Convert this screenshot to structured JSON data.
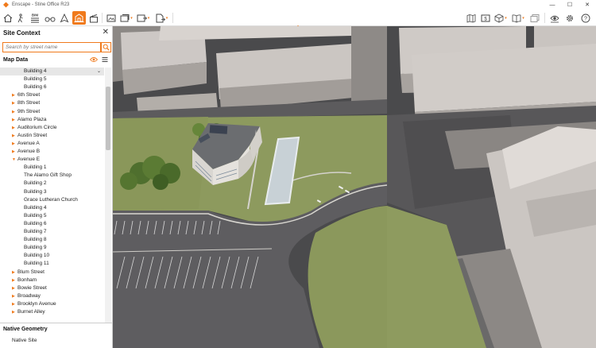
{
  "window": {
    "title": "Enscape - Stine Office R23",
    "controls": {
      "minimize": "—",
      "maximize": "☐",
      "close": "✕"
    }
  },
  "toolbar": {
    "bim_label": "BIM",
    "left_icons": [
      "home-icon",
      "walk-icon",
      "bim-info-icon",
      "binoculars-icon",
      "compass-icon",
      "site-context-icon",
      "clapperboard-icon"
    ],
    "middle_icons": [
      "screenshot-icon",
      "batch-render-icon",
      "export-image-icon",
      "export-web-icon"
    ],
    "right_icons": [
      "map-icon",
      "dollar-icon",
      "cube-icon",
      "book-icon",
      "material-icon",
      "visibility-icon",
      "settings-icon",
      "help-icon"
    ],
    "active_tool": "site-context-icon",
    "accent_color": "#f07a1c"
  },
  "panel": {
    "title": "Site Context",
    "search_placeholder": "Search by street name",
    "map_data_label": "Map Data",
    "tree": [
      {
        "label": "Building 4",
        "level": 1,
        "selected": true
      },
      {
        "label": "Building 5",
        "level": 1
      },
      {
        "label": "Building 6",
        "level": 1
      },
      {
        "label": "6th Street",
        "level": 0,
        "expanded": false
      },
      {
        "label": "8th Street",
        "level": 0,
        "expanded": false
      },
      {
        "label": "9th Street",
        "level": 0,
        "expanded": false
      },
      {
        "label": "Alamo Plaza",
        "level": 0,
        "expanded": false
      },
      {
        "label": "Auditorium Circle",
        "level": 0,
        "expanded": false
      },
      {
        "label": "Austin Street",
        "level": 0,
        "expanded": false
      },
      {
        "label": "Avenue A",
        "level": 0,
        "expanded": false
      },
      {
        "label": "Avenue B",
        "level": 0,
        "expanded": false
      },
      {
        "label": "Avenue E",
        "level": 0,
        "expanded": true
      },
      {
        "label": "Building 1",
        "level": 1
      },
      {
        "label": "The Alamo Gift Shop",
        "level": 1
      },
      {
        "label": "Building 2",
        "level": 1
      },
      {
        "label": "Building 3",
        "level": 1
      },
      {
        "label": "Grace Lutheran Church",
        "level": 1
      },
      {
        "label": "Building 4",
        "level": 1
      },
      {
        "label": "Building 5",
        "level": 1
      },
      {
        "label": "Building 6",
        "level": 1
      },
      {
        "label": "Building 7",
        "level": 1
      },
      {
        "label": "Building 8",
        "level": 1
      },
      {
        "label": "Building 9",
        "level": 1
      },
      {
        "label": "Building 10",
        "level": 1
      },
      {
        "label": "Building 11",
        "level": 1
      },
      {
        "label": "Blum Street",
        "level": 0,
        "expanded": false
      },
      {
        "label": "Bonham",
        "level": 0,
        "expanded": false
      },
      {
        "label": "Bowie Street",
        "level": 0,
        "expanded": false
      },
      {
        "label": "Broadway",
        "level": 0,
        "expanded": false
      },
      {
        "label": "Brooklyn Avenue",
        "level": 0,
        "expanded": false
      },
      {
        "label": "Burnet Alley",
        "level": 0,
        "expanded": false
      }
    ],
    "native_geometry_title": "Native Geometry",
    "native_geometry_items": [
      "Native Site"
    ]
  }
}
